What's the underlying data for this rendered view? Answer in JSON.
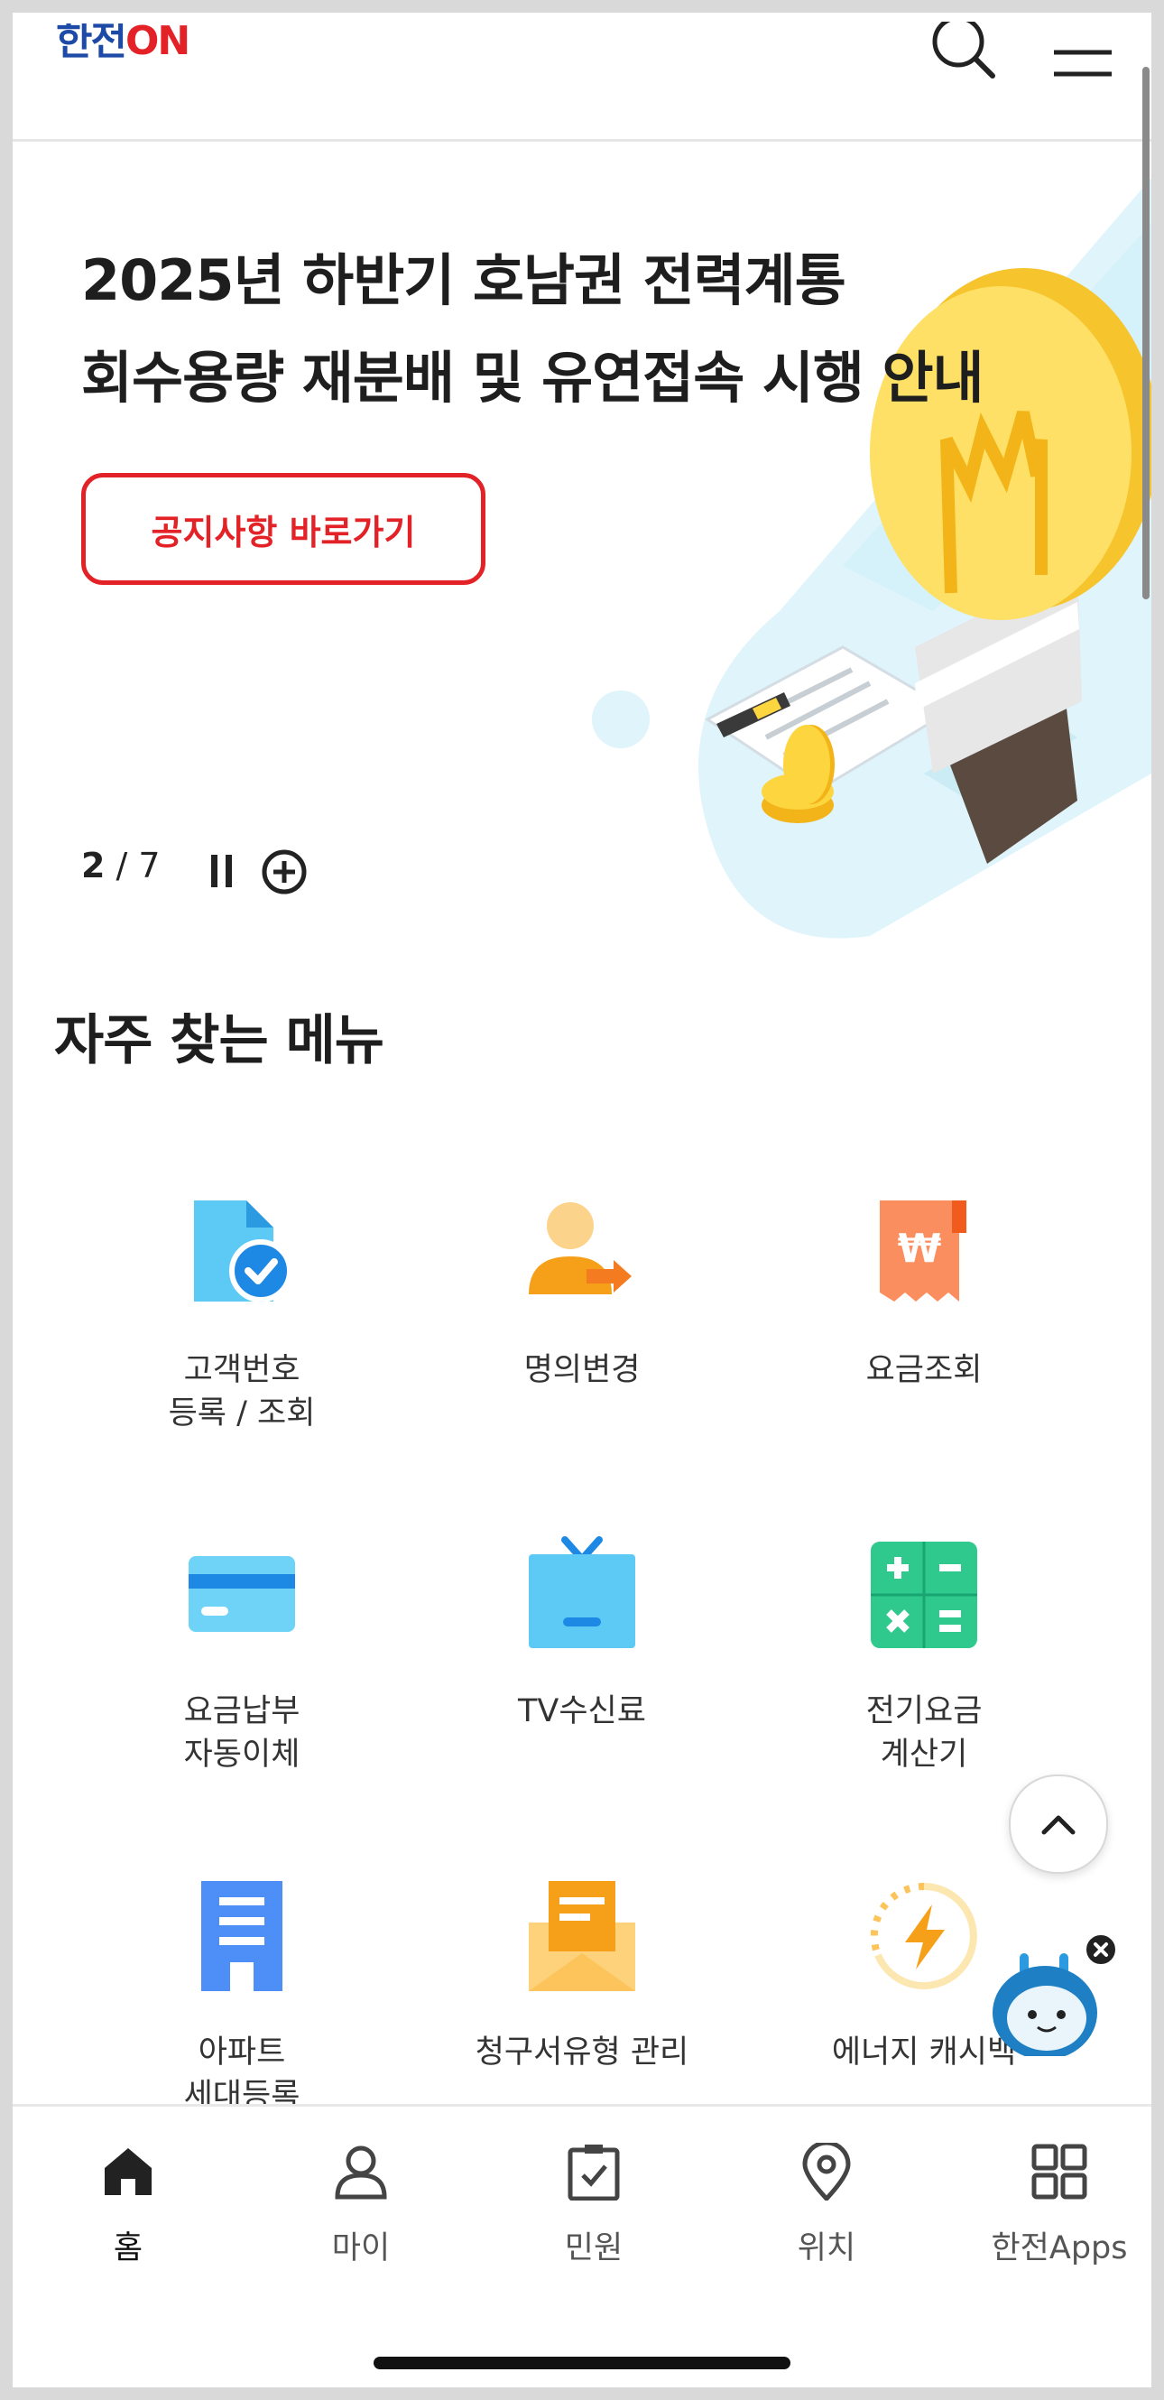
{
  "header": {
    "logo_text_blue": "한전",
    "logo_text_red": "ON",
    "search_icon": "search-icon",
    "menu_icon": "hamburger-menu-icon"
  },
  "hero": {
    "title_line1": "2025년 하반기 호남권 전력계통",
    "title_line2": "회수용량 재분배 및 유연접속 시행 안내",
    "button_label": "공지사항 바로가기",
    "slide_current": "2",
    "slide_separator": " / ",
    "slide_total": "7",
    "pause_icon": "pause-icon",
    "add_icon": "plus-circle-icon",
    "illustration": "lightbulb-contract-illustration"
  },
  "frequent_menu": {
    "title": "자주 찾는 메뉴",
    "items": [
      {
        "label": "고객번호\n등록 / 조회",
        "icon": "document-check-icon"
      },
      {
        "label": "명의변경",
        "icon": "person-transfer-icon"
      },
      {
        "label": "요금조회",
        "icon": "won-receipt-icon"
      },
      {
        "label": "요금납부\n자동이체",
        "icon": "credit-card-icon"
      },
      {
        "label": "TV수신료",
        "icon": "tv-icon"
      },
      {
        "label": "전기요금\n계산기",
        "icon": "calculator-icon"
      },
      {
        "label": "아파트\n세대등록",
        "icon": "apartment-building-icon"
      },
      {
        "label": "청구서유형 관리",
        "icon": "envelope-letter-icon"
      },
      {
        "label": "에너지 캐시백",
        "icon": "energy-cashback-icon"
      }
    ]
  },
  "floating": {
    "scroll_top_icon": "chevron-up-icon",
    "chatbot_icon": "chatbot-robot-icon",
    "close_icon": "close-icon"
  },
  "bottom_nav": {
    "items": [
      {
        "label": "홈",
        "icon": "home-icon",
        "active": true
      },
      {
        "label": "마이",
        "icon": "person-icon",
        "active": false
      },
      {
        "label": "민원",
        "icon": "clipboard-check-icon",
        "active": false
      },
      {
        "label": "위치",
        "icon": "location-pin-icon",
        "active": false
      },
      {
        "label": "한전Apps",
        "icon": "grid-apps-icon",
        "active": false
      }
    ]
  },
  "colors": {
    "brand_red": "#e32228",
    "brand_blue": "#1d4aa6",
    "illustration_sky": "#dff4fb",
    "bulb_yellow": "#fcd53f"
  }
}
